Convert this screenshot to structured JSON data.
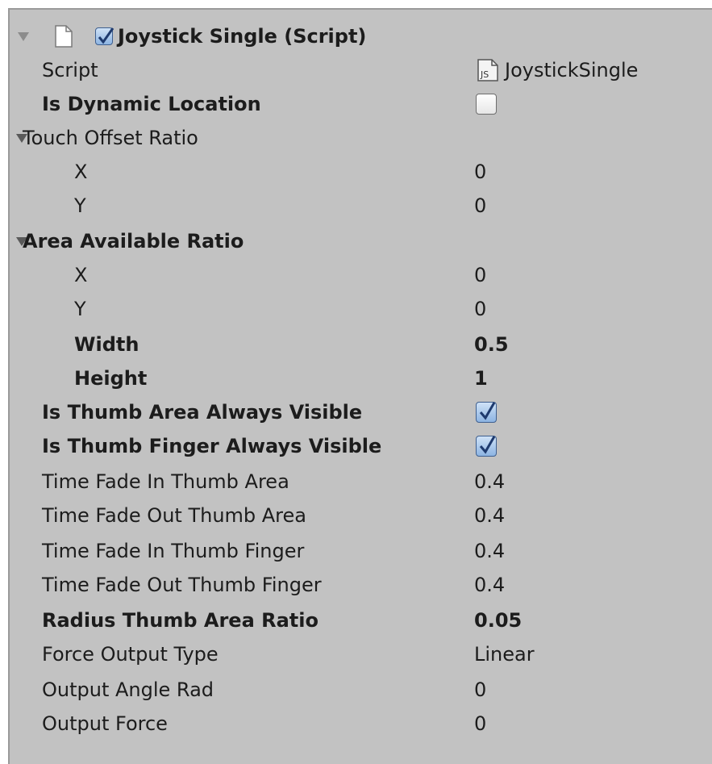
{
  "component": {
    "title": "Joystick Single (Script)",
    "enabled": true,
    "script_label": "Script",
    "script_value": "JoystickSingle",
    "script_icon_text": "JS"
  },
  "fields": {
    "is_dynamic_location": {
      "label": "Is Dynamic Location",
      "checked": false
    },
    "touch_offset_ratio": {
      "label": "Touch Offset Ratio",
      "x_label": "X",
      "x_value": "0",
      "y_label": "Y",
      "y_value": "0"
    },
    "area_available_ratio": {
      "label": "Area Available Ratio",
      "x_label": "X",
      "x_value": "0",
      "y_label": "Y",
      "y_value": "0",
      "width_label": "Width",
      "width_value": "0.5",
      "height_label": "Height",
      "height_value": "1"
    },
    "is_thumb_area_always_visible": {
      "label": "Is Thumb Area Always Visible",
      "checked": true
    },
    "is_thumb_finger_always_visible": {
      "label": "Is Thumb Finger Always Visible",
      "checked": true
    },
    "time_fade_in_thumb_area": {
      "label": "Time Fade In Thumb Area",
      "value": "0.4"
    },
    "time_fade_out_thumb_area": {
      "label": "Time Fade Out Thumb Area",
      "value": "0.4"
    },
    "time_fade_in_thumb_finger": {
      "label": "Time Fade In Thumb Finger",
      "value": "0.4"
    },
    "time_fade_out_thumb_finger": {
      "label": "Time Fade Out Thumb Finger",
      "value": "0.4"
    },
    "radius_thumb_area_ratio": {
      "label": "Radius Thumb Area Ratio",
      "value": "0.05"
    },
    "force_output_type": {
      "label": "Force Output Type",
      "value": "Linear"
    },
    "output_angle_rad": {
      "label": "Output Angle Rad",
      "value": "0"
    },
    "output_force": {
      "label": "Output Force",
      "value": "0"
    }
  },
  "colors": {
    "panel_bg": "#c2c2c2",
    "text": "#1c1c1c",
    "checkbox_checked": "#8db4e2",
    "checkmark": "#1e3a6e"
  }
}
